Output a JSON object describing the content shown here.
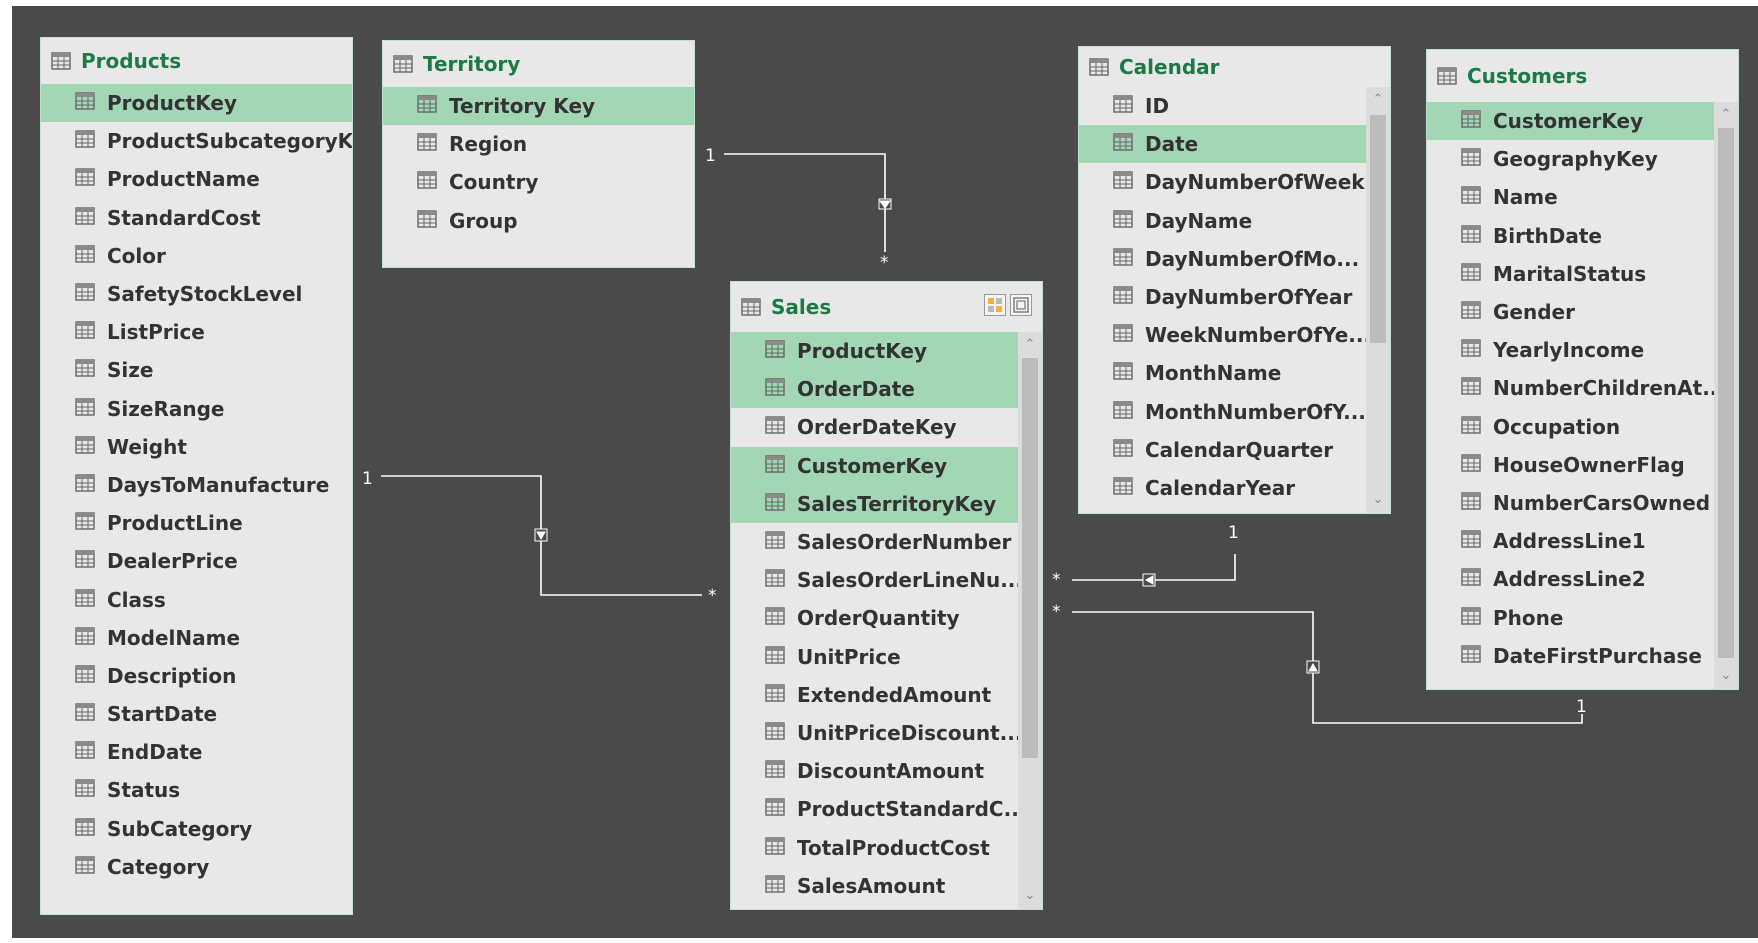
{
  "colors": {
    "background": "#4a4a4a",
    "table_bg": "#e8e8e8",
    "header_text": "#1b7a45",
    "highlight": "#a3d6b5",
    "field_text": "#333333",
    "relationship_line": "#ffffff"
  },
  "tables": {
    "products": {
      "title": "Products",
      "fields": [
        "ProductKey",
        "ProductSubcategoryK...",
        "ProductName",
        "StandardCost",
        "Color",
        "SafetyStockLevel",
        "ListPrice",
        "Size",
        "SizeRange",
        "Weight",
        "DaysToManufacture",
        "ProductLine",
        "DealerPrice",
        "Class",
        "ModelName",
        "Description",
        "StartDate",
        "EndDate",
        "Status",
        "SubCategory",
        "Category"
      ],
      "highlighted": [
        0
      ]
    },
    "territory": {
      "title": "Territory",
      "fields": [
        "Territory Key",
        "Region",
        "Country",
        "Group"
      ],
      "highlighted": [
        0
      ]
    },
    "calendar": {
      "title": "Calendar",
      "fields": [
        "ID",
        "Date",
        "DayNumberOfWeek",
        "DayName",
        "DayNumberOfMo...",
        "DayNumberOfYear",
        "WeekNumberOfYe...",
        "MonthName",
        "MonthNumberOfY...",
        "CalendarQuarter",
        "CalendarYear"
      ],
      "highlighted": [
        1
      ]
    },
    "customers": {
      "title": "Customers",
      "fields": [
        "CustomerKey",
        "GeographyKey",
        "Name",
        "BirthDate",
        "MaritalStatus",
        "Gender",
        "YearlyIncome",
        "NumberChildrenAt...",
        "Occupation",
        "HouseOwnerFlag",
        "NumberCarsOwned",
        "AddressLine1",
        "AddressLine2",
        "Phone",
        "DateFirstPurchase"
      ],
      "highlighted": [
        0
      ]
    },
    "sales": {
      "title": "Sales",
      "fields": [
        "ProductKey",
        "OrderDate",
        "OrderDateKey",
        "CustomerKey",
        "SalesTerritoryKey",
        "SalesOrderNumber",
        "SalesOrderLineNu...",
        "OrderQuantity",
        "UnitPrice",
        "ExtendedAmount",
        "UnitPriceDiscount...",
        "DiscountAmount",
        "ProductStandardC...",
        "TotalProductCost",
        "SalesAmount"
      ],
      "highlighted": [
        0,
        1,
        3,
        4
      ]
    }
  },
  "relationships": [
    {
      "from": "Territory",
      "to": "Sales",
      "one_label": "1",
      "many_label": "*"
    },
    {
      "from": "Products",
      "to": "Sales",
      "one_label": "1",
      "many_label": "*"
    },
    {
      "from": "Calendar",
      "to": "Sales",
      "one_label": "1",
      "many_label": "*"
    },
    {
      "from": "Customers",
      "to": "Sales",
      "one_label": "1",
      "many_label": "*"
    }
  ]
}
